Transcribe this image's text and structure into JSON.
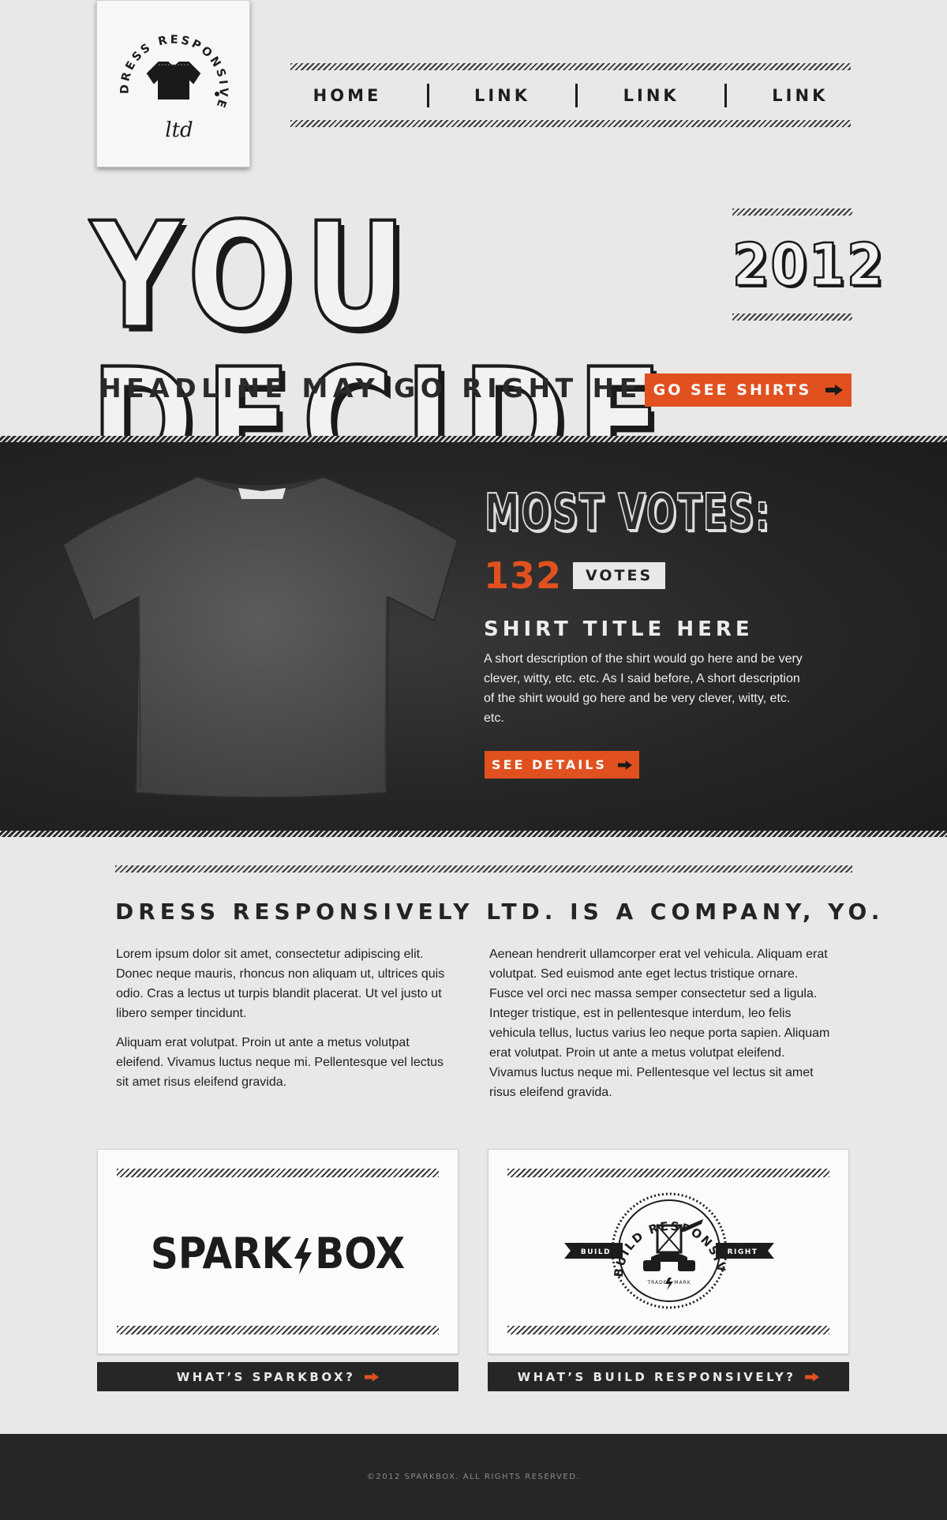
{
  "brand": {
    "logo_arc_text": "DRESS RESPONSIVELY",
    "logo_sub_text": "ltd"
  },
  "nav": {
    "items": [
      {
        "label": "HOME"
      },
      {
        "label": "LINK"
      },
      {
        "label": "LINK"
      },
      {
        "label": "LINK"
      }
    ]
  },
  "hero": {
    "title": "YOU DECIDE",
    "year": "2012",
    "headline": "HEADLINE MAY GO RIGHT HERE.",
    "cta_label": "GO SEE SHIRTS"
  },
  "feature": {
    "heading": "MOST VOTES:",
    "vote_count": "132",
    "vote_label": "VOTES",
    "shirt_title": "SHIRT TITLE HERE",
    "shirt_description": "A short description of the shirt would go here and be very clever, witty, etc. etc. As I said before, A short description of the shirt would go here and be very clever, witty, etc. etc.",
    "details_label": "SEE DETAILS"
  },
  "about": {
    "title": "DRESS RESPONSIVELY LTD. IS A COMPANY, YO.",
    "left_paragraphs": [
      "Lorem ipsum dolor sit amet, consectetur adipiscing elit. Donec neque mauris, rhoncus non aliquam ut, ultrices quis odio. Cras a lectus ut turpis blandit placerat. Ut vel justo ut libero semper tincidunt.",
      "Aliquam erat volutpat. Proin ut ante a metus volutpat eleifend. Vivamus luctus neque mi. Pellentesque vel lectus sit amet risus eleifend gravida."
    ],
    "right_paragraphs": [
      "Aenean hendrerit ullamcorper erat vel vehicula. Aliquam erat volutpat. Sed euismod ante eget lectus tristique ornare. Fusce vel orci nec massa semper consectetur sed a ligula. Integer tristique, est in pellentesque interdum, leo felis vehicula tellus, luctus varius leo neque porta sapien. Aliquam erat volutpat. Proin ut ante a metus volutpat eleifend. Vivamus luctus neque mi. Pellentesque vel lectus sit amet risus eleifend gravida."
    ]
  },
  "partners": [
    {
      "logo_text_left": "SPARK",
      "logo_text_right": "BOX",
      "link_label": "WHAT’S SPARKBOX?"
    },
    {
      "logo_arc_text": "BUILD RESPONSIVELY",
      "left_banner": "BUILD",
      "right_banner": "RIGHT",
      "trade_left": "TRADE",
      "trade_right": "MARK",
      "link_label": "WHAT’S BUILD RESPONSIVELY?"
    }
  ],
  "footer": {
    "copyright": "©2012 SPARKBOX. ALL RIGHTS RESERVED."
  },
  "colors": {
    "accent": "#e0511f",
    "dark": "#262626",
    "paper": "#e9e8e6"
  }
}
